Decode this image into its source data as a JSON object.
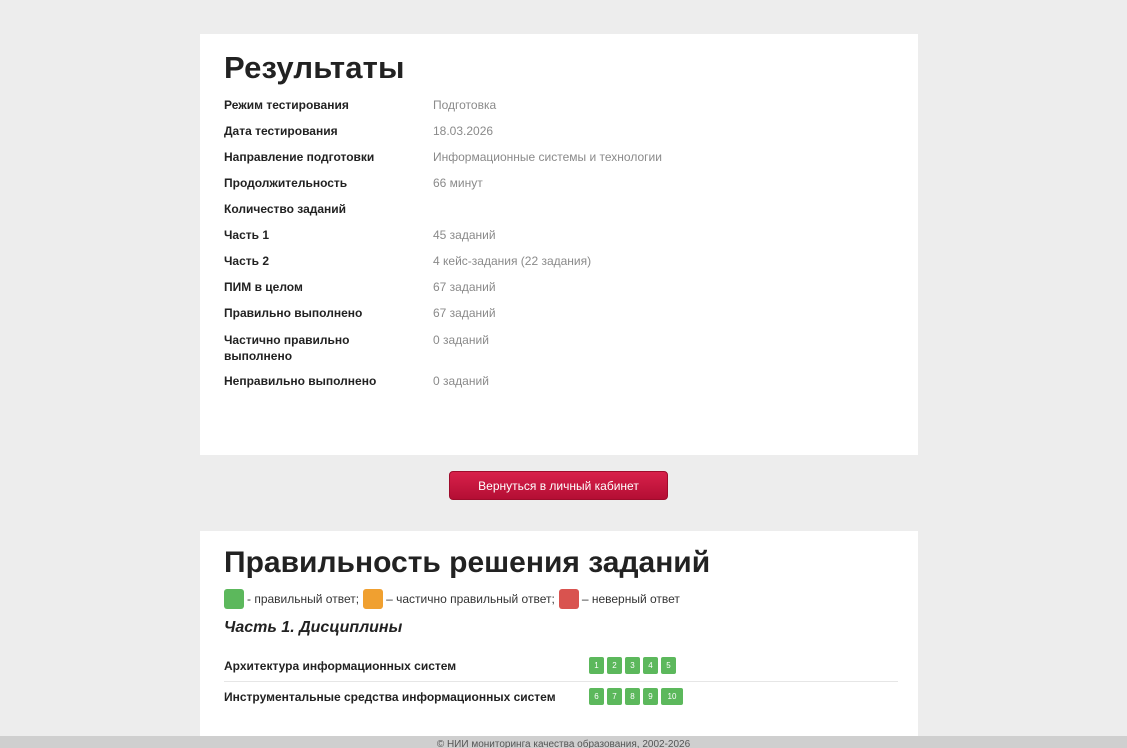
{
  "results": {
    "title": "Результаты",
    "rows": [
      {
        "label": "Режим тестирования",
        "value": "Подготовка"
      },
      {
        "label": "Дата тестирования",
        "value": "18.03.2026"
      },
      {
        "label": "Направление подготовки",
        "value": "Информационные системы и технологии"
      },
      {
        "label": "Продолжительность",
        "value": "66 минут"
      },
      {
        "label": "Количество заданий",
        "value": ""
      },
      {
        "label": "Часть 1",
        "value": "45 заданий"
      },
      {
        "label": "Часть 2",
        "value": "4 кейс-задания (22 задания)"
      },
      {
        "label": "ПИМ в целом",
        "value": "67 заданий"
      },
      {
        "label": "Правильно выполнено",
        "value": "67 заданий"
      },
      {
        "label": "Частично правильно выполнено",
        "value": "0 заданий"
      },
      {
        "label": "Неправильно выполнено",
        "value": "0 заданий"
      }
    ]
  },
  "back_button": {
    "label": "Вернуться в личный кабинет"
  },
  "tasks": {
    "title": "Правильность решения заданий",
    "legend": {
      "correct": "- правильный ответ;",
      "partial": "– частично правильный ответ;",
      "wrong": "– неверный ответ"
    },
    "colors": {
      "correct": "#5cb85c",
      "partial": "#f0a030",
      "wrong": "#d9534f"
    },
    "part1_title": "Часть 1. Дисциплины",
    "disciplines": [
      {
        "name": "Архитектура информационных систем",
        "tasks": [
          "1",
          "2",
          "3",
          "4",
          "5"
        ]
      },
      {
        "name": "Инструментальные средства информационных систем",
        "tasks": [
          "6",
          "7",
          "8",
          "9",
          "10"
        ]
      }
    ]
  },
  "footer": {
    "text": "© НИИ мониторинга качества образования, 2002-2026"
  }
}
